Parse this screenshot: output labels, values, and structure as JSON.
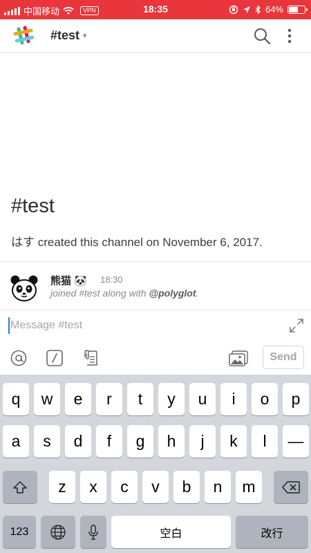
{
  "status_bar": {
    "carrier": "中国移动",
    "vpn": "VPN",
    "time": "18:35",
    "battery": "64%",
    "battery_level": 0.64,
    "bg_color": "#e8363c"
  },
  "header": {
    "channel_name": "#test",
    "icons": [
      "slack-logo-icon",
      "chevron-down-icon",
      "search-icon",
      "more-vertical-icon"
    ]
  },
  "intro": {
    "title": "#test",
    "creator": "はす",
    "created_text": " created this channel on November 6, 2017."
  },
  "message": {
    "author": "熊猫 🐼",
    "time": "18:30",
    "text_before": "joined #test along with ",
    "mention": "@polyglot",
    "text_after": "."
  },
  "composer": {
    "placeholder": "Message #test",
    "send_label": "Send",
    "tools": [
      "at-icon",
      "slash-command-icon",
      "attach-file-icon",
      "photo-icon",
      "expand-icon"
    ]
  },
  "keyboard": {
    "row1": [
      "q",
      "w",
      "e",
      "r",
      "t",
      "y",
      "u",
      "i",
      "o",
      "p"
    ],
    "row2": [
      "a",
      "s",
      "d",
      "f",
      "g",
      "h",
      "j",
      "k",
      "l",
      "—"
    ],
    "row3": [
      "z",
      "x",
      "c",
      "v",
      "b",
      "n",
      "m"
    ],
    "numbers_label": "123",
    "space_label": "空白",
    "return_label": "改行"
  }
}
